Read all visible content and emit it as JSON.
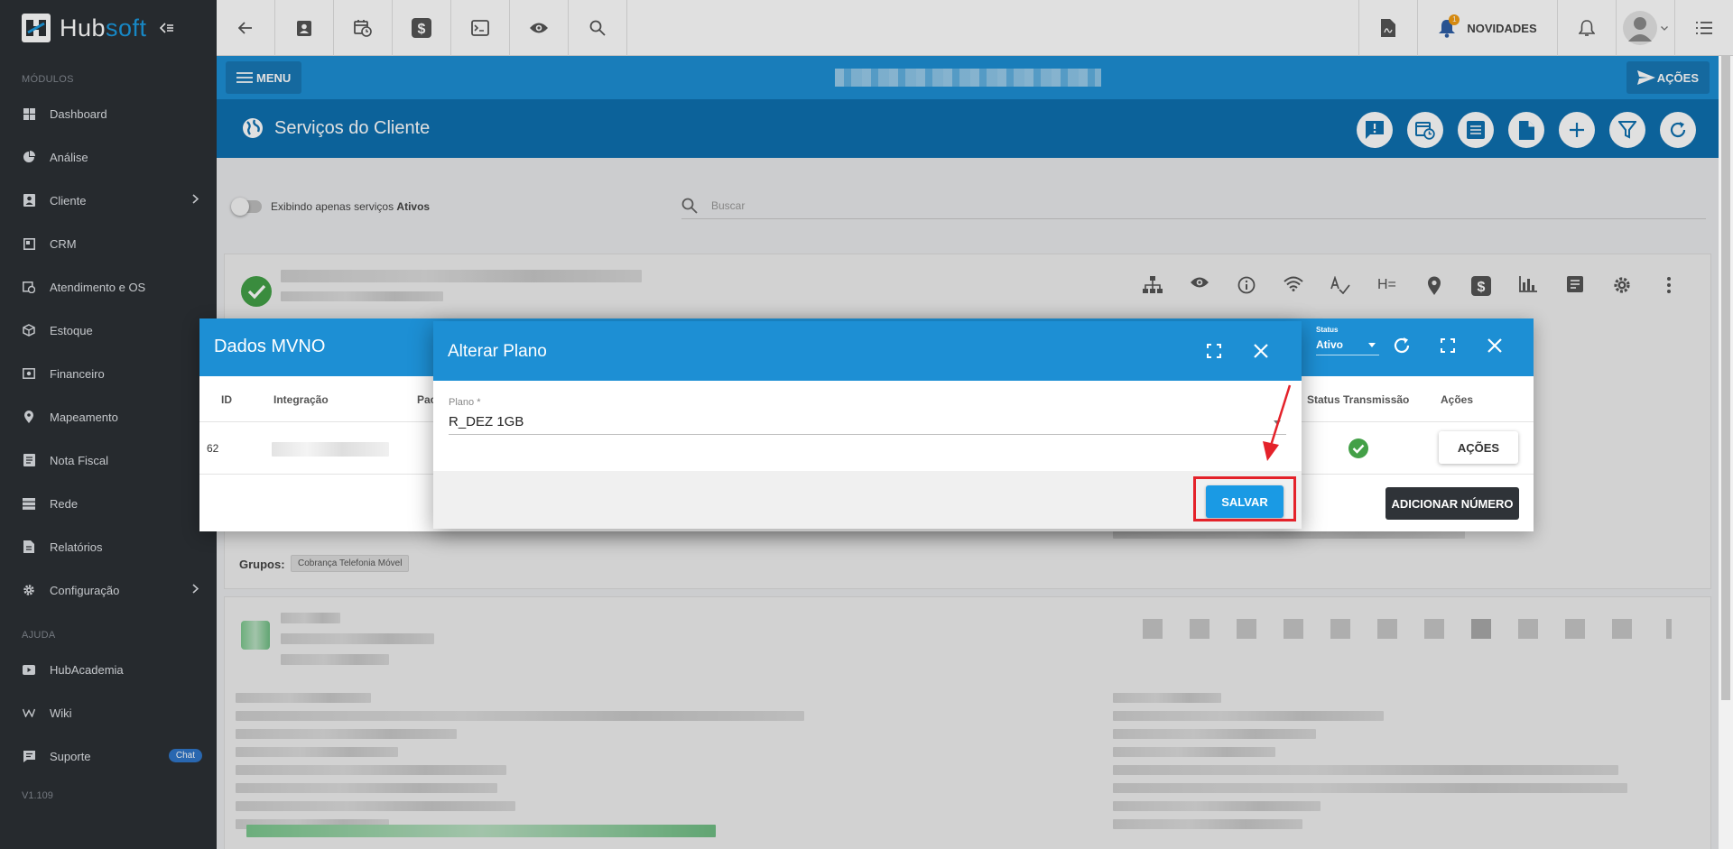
{
  "brand": {
    "name_part1": "Hub",
    "name_part2": "soft"
  },
  "sidebar": {
    "section_modules": "MÓDULOS",
    "items": [
      {
        "label": "Dashboard",
        "icon": "dashboard-icon"
      },
      {
        "label": "Análise",
        "icon": "chart-pie-icon"
      },
      {
        "label": "Cliente",
        "icon": "contact-icon",
        "has_children": true
      },
      {
        "label": "CRM",
        "icon": "crm-icon"
      },
      {
        "label": "Atendimento e OS",
        "icon": "calendar-clock-icon"
      },
      {
        "label": "Estoque",
        "icon": "box-icon"
      },
      {
        "label": "Financeiro",
        "icon": "money-icon"
      },
      {
        "label": "Mapeamento",
        "icon": "map-pin-icon"
      },
      {
        "label": "Nota Fiscal",
        "icon": "invoice-icon"
      },
      {
        "label": "Rede",
        "icon": "server-icon"
      },
      {
        "label": "Relatórios",
        "icon": "report-icon"
      },
      {
        "label": "Configuração",
        "icon": "gear-icon",
        "has_children": true
      }
    ],
    "section_help": "AJUDA",
    "help_items": [
      {
        "label": "HubAcademia",
        "icon": "play-icon"
      },
      {
        "label": "Wiki",
        "icon": "wiki-icon"
      },
      {
        "label": "Suporte",
        "icon": "chat-icon",
        "badge": "Chat"
      }
    ],
    "version": "V1.109"
  },
  "topbar": {
    "novidades_label": "NOVIDADES",
    "notification_count": "1"
  },
  "bar": {
    "menu_label": "MENU",
    "acoes_label": "AÇÕES"
  },
  "page": {
    "title": "Serviços do Cliente",
    "filter_label_prefix": "Exibindo apenas serviços ",
    "filter_label_strong": "Ativos",
    "search_placeholder": "Buscar"
  },
  "cards": {
    "grupos_label": "Grupos:",
    "grupos_chip": "Cobrança Telefonia Móvel"
  },
  "dados_mvno": {
    "title": "Dados MVNO",
    "status_label": "Status",
    "status_value": "Ativo",
    "columns": {
      "id": "ID",
      "integracao": "Integração",
      "pac": "Pac",
      "status_transmissao": "Status Transmissão",
      "acoes": "Ações"
    },
    "row": {
      "id": "62"
    },
    "row_action_label": "AÇÕES",
    "add_number_label": "ADICIONAR NÚMERO"
  },
  "alterar_plano": {
    "title": "Alterar Plano",
    "field_label": "Plano *",
    "field_value": "R_DEZ 1GB",
    "save_label": "SALVAR"
  },
  "colors": {
    "sidebar_bg": "#2c3035",
    "primary_blue": "#1d8fd4",
    "dark_blue": "#0e70b0",
    "success_green": "#43a047",
    "highlight_red": "#e4222a"
  }
}
